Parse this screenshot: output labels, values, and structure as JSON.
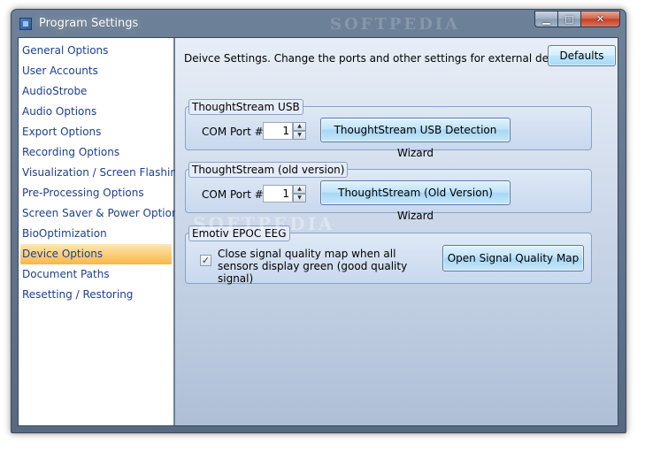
{
  "window": {
    "title": "Program Settings"
  },
  "caption_buttons": {
    "minimize": "▁",
    "maximize": "□",
    "close": "✕"
  },
  "sidebar": {
    "items": [
      {
        "label": "General Options"
      },
      {
        "label": "User Accounts"
      },
      {
        "label": "AudioStrobe"
      },
      {
        "label": "Audio Options"
      },
      {
        "label": "Export Options"
      },
      {
        "label": "Recording Options"
      },
      {
        "label": "Visualization / Screen Flashing"
      },
      {
        "label": "Pre-Processing Options"
      },
      {
        "label": "Screen Saver & Power Options"
      },
      {
        "label": "BioOptimization"
      },
      {
        "label": "Device Options",
        "active": true
      },
      {
        "label": "Document Paths"
      },
      {
        "label": "Resetting / Restoring"
      }
    ]
  },
  "content": {
    "description": "Deivce Settings. Change the ports and other settings for external devices",
    "defaults_button": "Defaults",
    "groups": {
      "usb": {
        "title": "ThoughtStream USB",
        "com_label": "COM Port #:",
        "com_value": "1",
        "wizard_button": "ThoughtStream USB Detection Wizard"
      },
      "old": {
        "title": "ThoughtStream (old version)",
        "com_label": "COM Port #:",
        "com_value": "1",
        "wizard_button": "ThoughtStream (Old Version) Wizard"
      },
      "emotiv": {
        "title": "Emotiv EPOC EEG",
        "checkbox_checked": true,
        "checkbox_label": "Close signal quality map when all sensors display green (good quality signal)",
        "map_button": "Open Signal Quality Map"
      }
    }
  },
  "watermark": "SOFTPEDIA"
}
